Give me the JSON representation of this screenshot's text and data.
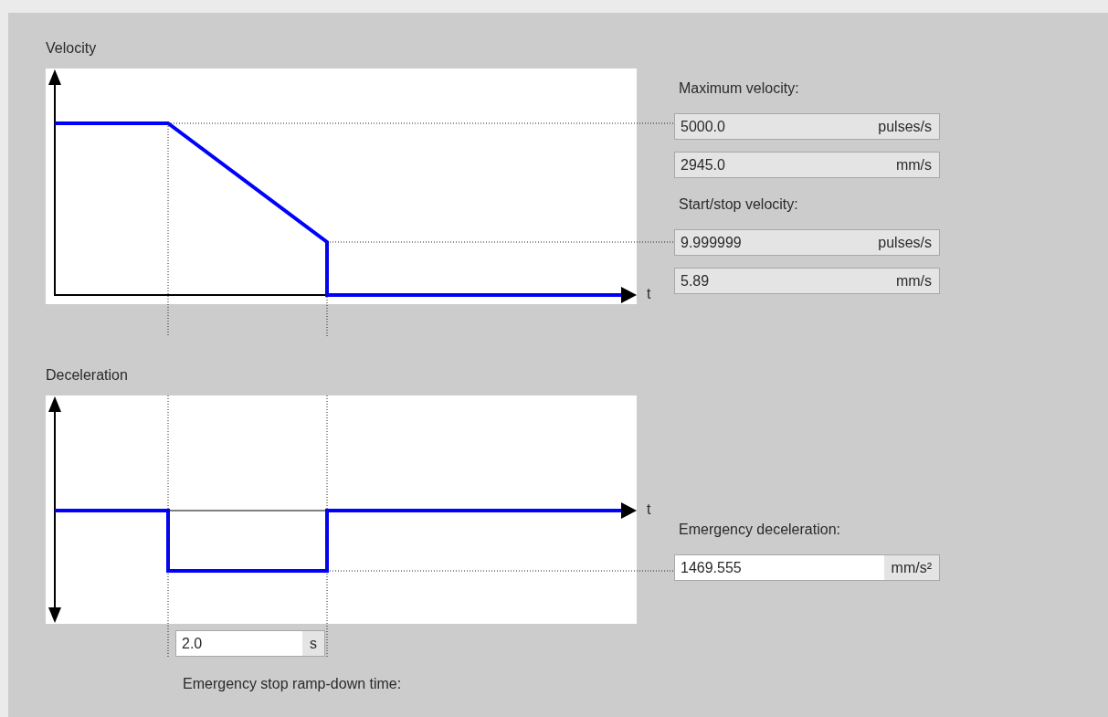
{
  "velocity_panel": {
    "title": "Velocity",
    "time_axis_label": "t"
  },
  "deceleration_panel": {
    "title": "Deceleration",
    "time_axis_label": "t"
  },
  "ramp_down_time": {
    "field": {
      "value": "2.0",
      "unit": "s",
      "editable": true
    },
    "label": "Emergency stop ramp-down time:"
  },
  "parameters": [
    {
      "label": "Maximum velocity:",
      "fields": [
        {
          "value": "5000.0",
          "unit": "pulses/s",
          "editable": false
        },
        {
          "value": "2945.0",
          "unit": "mm/s",
          "editable": false
        }
      ]
    },
    {
      "label": "Start/stop velocity:",
      "fields": [
        {
          "value": "9.999999",
          "unit": "pulses/s",
          "editable": false
        },
        {
          "value": "5.89",
          "unit": "mm/s",
          "editable": false
        }
      ]
    },
    {
      "label": "Emergency deceleration:",
      "fields": [
        {
          "value": "1469.555",
          "unit": "mm/s²",
          "editable": true
        }
      ]
    }
  ]
}
